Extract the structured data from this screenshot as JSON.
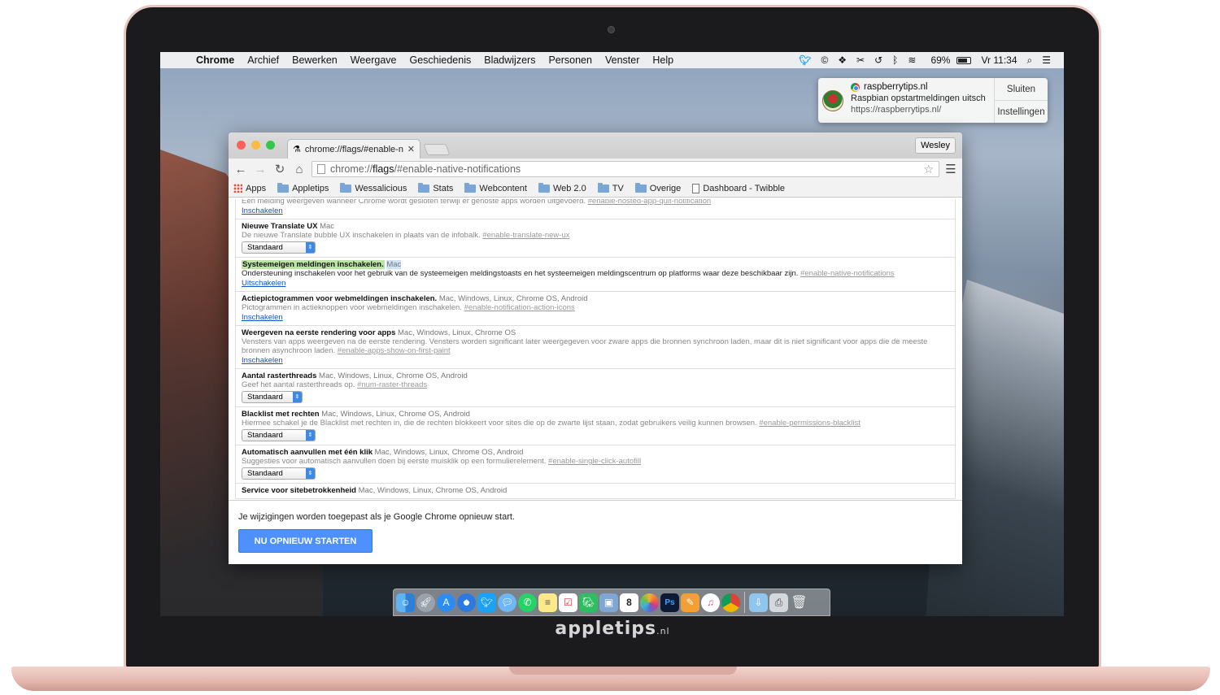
{
  "brand": {
    "name": "appletips",
    "suffix": ".nl"
  },
  "menubar": {
    "app": "Chrome",
    "items": [
      "Archief",
      "Bewerken",
      "Weergave",
      "Geschiedenis",
      "Bladwijzers",
      "Personen",
      "Venster",
      "Help"
    ],
    "battery": "69%",
    "clock": "Vr 11:34"
  },
  "notification": {
    "site": "raspberrytips.nl",
    "message": "Raspbian opstartmeldingen uitsch",
    "url": "https://raspberrytips.nl/",
    "close_label": "Sluiten",
    "settings_label": "Instellingen"
  },
  "browser": {
    "tab_title": "chrome://flags/#enable-nat",
    "profile": "Wesley",
    "url_scheme": "chrome://",
    "url_host": "flags",
    "url_rest": "/#enable-native-notifications",
    "bookmarks": [
      "Apps",
      "Appletips",
      "Wessalicious",
      "Stats",
      "Webcontent",
      "Web 2.0",
      "TV",
      "Overige",
      "Dashboard - Twibble"
    ]
  },
  "flags": {
    "top_partial": {
      "desc": "Een melding weergeven wanneer Chrome wordt gesloten terwijl er gehoste apps worden uitgevoerd.",
      "hash": "#enable-hosted-app-quit-notification",
      "action": "Inschakelen"
    },
    "items": [
      {
        "title": "Nieuwe Translate UX",
        "platforms": "Mac",
        "desc": "De nieuwe Translate bubble UX inschakelen in plaats van de infobalk.",
        "hash": "#enable-translate-new-ux",
        "select": "Standaard"
      },
      {
        "title": "Systeemeigen meldingen inschakelen.",
        "platforms": "Mac",
        "desc": "Ondersteuning inschakelen voor het gebruik van de systeemeigen meldingstoasts en het systeemeigen meldingscentrum op platforms waar deze beschikbaar zijn.",
        "hash": "#enable-native-notifications",
        "action": "Uitschakelen"
      },
      {
        "title": "Actiepictogrammen voor webmeldingen inschakelen.",
        "platforms": "Mac, Windows, Linux, Chrome OS, Android",
        "desc": "Pictogrammen in actieknoppen voor webmeldingen inschakelen.",
        "hash": "#enable-notification-action-icons",
        "action": "Inschakelen"
      },
      {
        "title": "Weergeven na eerste rendering voor apps",
        "platforms": "Mac, Windows, Linux, Chrome OS",
        "desc": "Vensters van apps weergeven na de eerste rendering. Vensters worden significant later weergegeven voor zware apps die bronnen synchroon laden, maar dit is niet significant voor apps die de meeste bronnen asynchroon laden.",
        "hash": "#enable-apps-show-on-first-paint",
        "action": "Inschakelen"
      },
      {
        "title": "Aantal rasterthreads",
        "platforms": "Mac, Windows, Linux, Chrome OS, Android",
        "desc": "Geef het aantal rasterthreads op.",
        "hash": "#num-raster-threads",
        "select": "Standaard"
      },
      {
        "title": "Blacklist met rechten",
        "platforms": "Mac, Windows, Linux, Chrome OS, Android",
        "desc": "Hiermee schakel je de Blacklist met rechten in, die de rechten blokkeert voor sites die op de zwarte lijst staan, zodat gebruikers veilig kunnen browsen.",
        "hash": "#enable-permissions-blacklist",
        "select": "Standaard"
      },
      {
        "title": "Automatisch aanvullen met één klik",
        "platforms": "Mac, Windows, Linux, Chrome OS, Android",
        "desc": "Suggesties voor automatisch aanvullen doen bij eerste muisklik op een formulierelement.",
        "hash": "#enable-single-click-autofill",
        "select": "Standaard"
      },
      {
        "title": "Service voor sitebetrokkenheid",
        "platforms": "Mac, Windows, Linux, Chrome OS, Android",
        "desc": "",
        "hash": ""
      }
    ],
    "footer_message": "Je wijzigingen worden toegepast als je Google Chrome opnieuw start.",
    "restart_label": "NU OPNIEUW STARTEN"
  },
  "dock": {
    "icons": [
      "finder-icon",
      "launchpad-icon",
      "app-store-icon",
      "safari-icon",
      "twitter-icon",
      "messages-icon",
      "whatsapp-icon",
      "notes-icon",
      "reminders-icon",
      "evernote-icon",
      "preview-icon",
      "calendar-icon",
      "photos-icon",
      "photoshop-icon",
      "pages-icon",
      "itunes-icon",
      "chrome-icon",
      "downloads-folder-icon",
      "screenshot-icon",
      "trash-icon"
    ],
    "calendar_day": "8",
    "photoshop_label": "Ps"
  }
}
